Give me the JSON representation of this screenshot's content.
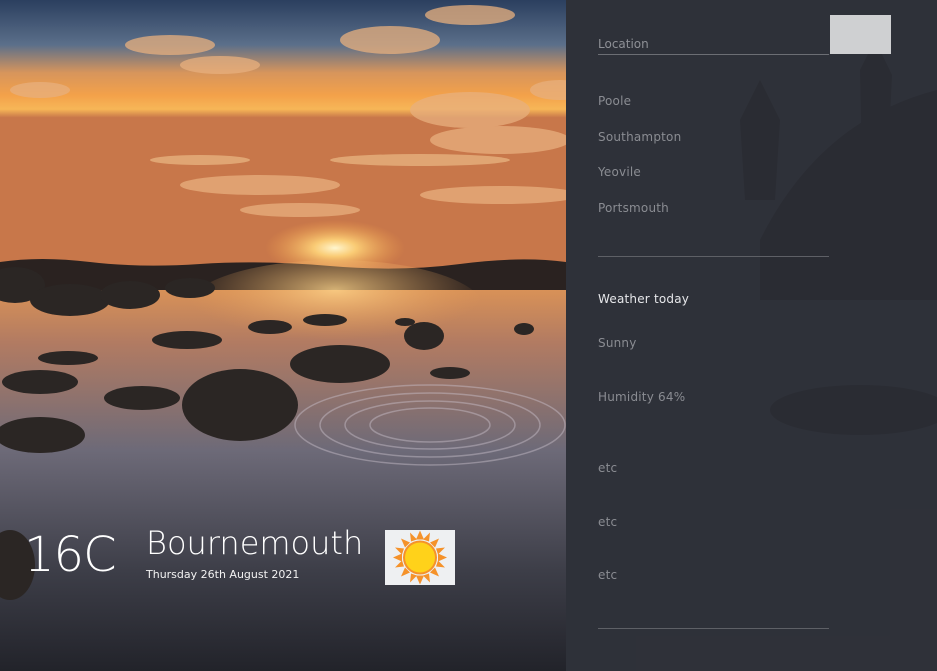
{
  "search": {
    "placeholder": "Location",
    "button_label": ""
  },
  "cities": [
    {
      "label": "Poole"
    },
    {
      "label": "Southampton"
    },
    {
      "label": "Yeovile"
    },
    {
      "label": "Portsmouth"
    }
  ],
  "details": {
    "title": "Weather today",
    "condition": "Sunny",
    "humidity": "Humidity 64%",
    "extra": [
      "etc",
      "etc",
      "etc"
    ]
  },
  "current": {
    "temperature": "16C",
    "city": "Bournemouth",
    "date": "Thursday 26th August 2021",
    "icon": "sun-icon"
  },
  "colors": {
    "panel": "#2c2e36",
    "sky_top": "#2d3f5c",
    "sun": "#ffd44a",
    "button": "#cfd0d2"
  }
}
